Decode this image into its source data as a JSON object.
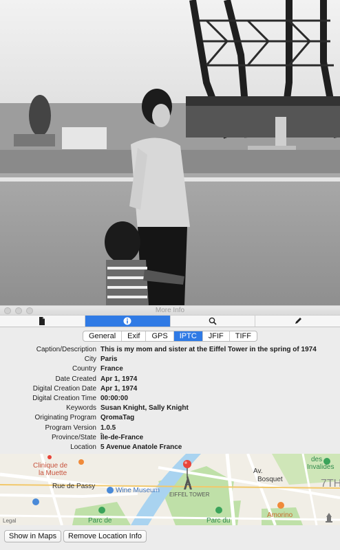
{
  "window": {
    "title": "More Info"
  },
  "toolbar": {
    "buttons": [
      {
        "icon": "document-icon",
        "active": false
      },
      {
        "icon": "info-icon",
        "active": true
      },
      {
        "icon": "magnifier-icon",
        "active": false
      },
      {
        "icon": "pencil-icon",
        "active": false
      }
    ]
  },
  "tabs": {
    "items": [
      "General",
      "Exif",
      "GPS",
      "IPTC",
      "JFIF",
      "TIFF"
    ],
    "selected": "IPTC"
  },
  "metadata": {
    "rows": [
      {
        "key": "Caption/Description",
        "value": "This is my mom and sister at the Eiffel Tower in the spring of 1974"
      },
      {
        "key": "City",
        "value": "Paris"
      },
      {
        "key": "Country",
        "value": "France"
      },
      {
        "key": "Date Created",
        "value": "Apr 1, 1974"
      },
      {
        "key": "Digital Creation Date",
        "value": "Apr 1, 1974"
      },
      {
        "key": "Digital Creation Time",
        "value": "00:00:00"
      },
      {
        "key": "Keywords",
        "value": "Susan Knight, Sally Knight"
      },
      {
        "key": "Originating Program",
        "value": "QromaTag"
      },
      {
        "key": "Program Version",
        "value": "1.0.5"
      },
      {
        "key": "Province/State",
        "value": "Île-de-France"
      },
      {
        "key": "Location",
        "value": "5 Avenue Anatole France"
      }
    ]
  },
  "map": {
    "labels": {
      "clinique": "Clinique de",
      "muette": "la Muette",
      "rue_passy": "Rue de Passy",
      "wine_museum": "Wine Museum",
      "eiffel": "EIFFEL TOWER",
      "des": "des",
      "invalides": "Invalides",
      "av": "Av.",
      "bosquet": "Bosquet",
      "amorino": "Amorino",
      "parc_de": "Parc de",
      "parc_du": "Parc du",
      "seventh": "7TH",
      "legal": "Legal"
    },
    "colors": {
      "park": "#bfe0a8",
      "water": "#a9d3f0",
      "road": "#ffffff",
      "pin": "#e8443a",
      "poi_orange": "#f08a3a",
      "poi_blue": "#4a8ad8"
    }
  },
  "buttons": {
    "show_in_maps": "Show in Maps",
    "remove_location": "Remove Location Info"
  },
  "accent_color": "#2f7ae5"
}
